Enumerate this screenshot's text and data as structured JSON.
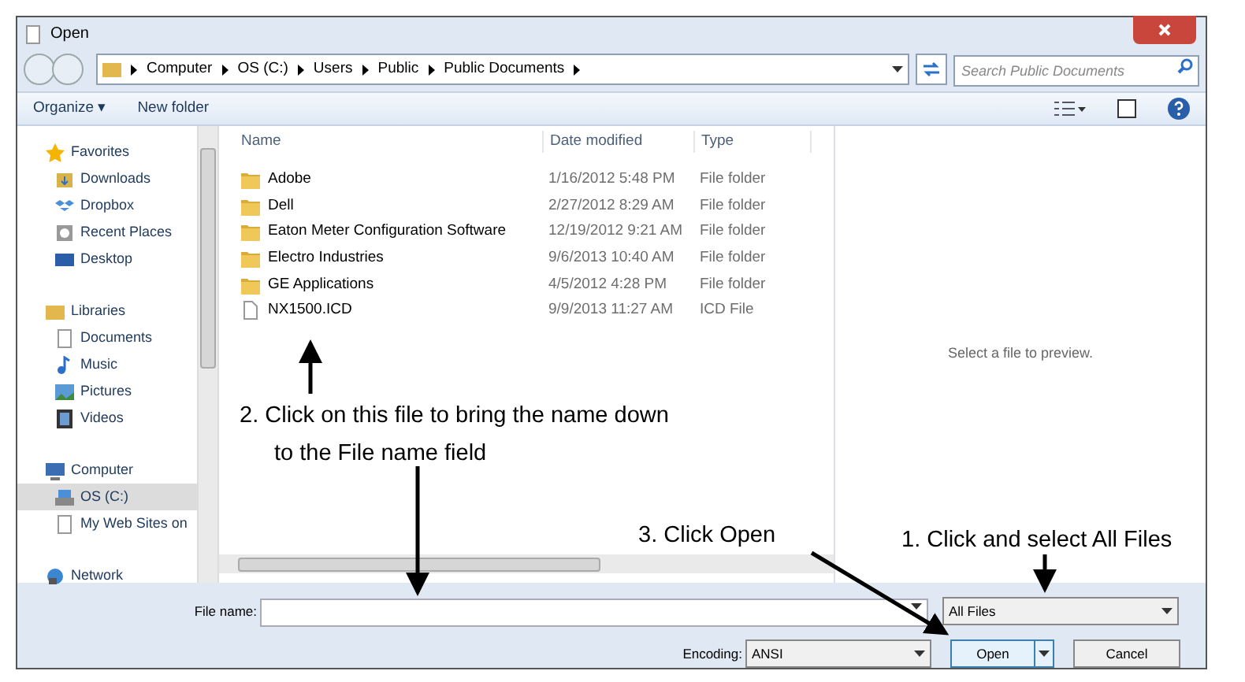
{
  "window": {
    "title": "Open"
  },
  "address": {
    "crumbs": [
      "Computer",
      "OS (C:)",
      "Users",
      "Public",
      "Public Documents"
    ]
  },
  "search": {
    "placeholder": "Search Public Documents"
  },
  "toolbar": {
    "buttons": [
      "Organize ▾",
      "New folder"
    ]
  },
  "sidebar": {
    "items": [
      {
        "label": "Favorites",
        "kind": "star",
        "selected": false,
        "children": [
          {
            "label": "Downloads",
            "kind": "downloads",
            "selected": false
          },
          {
            "label": "Dropbox",
            "kind": "dropbox",
            "selected": false
          },
          {
            "label": "Recent Places",
            "kind": "recent",
            "selected": false
          },
          {
            "label": "Desktop",
            "kind": "desktop",
            "selected": false
          }
        ]
      },
      {
        "label": "Libraries",
        "kind": "library",
        "selected": false,
        "children": [
          {
            "label": "Documents",
            "kind": "doc",
            "selected": false
          },
          {
            "label": "Music",
            "kind": "music",
            "selected": false
          },
          {
            "label": "Pictures",
            "kind": "pictures",
            "selected": false
          },
          {
            "label": "Videos",
            "kind": "videos",
            "selected": false
          }
        ]
      },
      {
        "label": "Computer",
        "kind": "computer",
        "selected": false,
        "children": [
          {
            "label": "OS (C:)",
            "kind": "drive",
            "selected": true
          },
          {
            "label": "My Web Sites on",
            "kind": "doc",
            "selected": false
          }
        ]
      },
      {
        "label": "Network",
        "kind": "network",
        "selected": false
      }
    ]
  },
  "table": {
    "columns": [
      "Name",
      "Date modified",
      "Type"
    ],
    "rows": [
      {
        "name": "Adobe",
        "date": "1/16/2012 5:48 PM",
        "type": "File folder",
        "kind": "folder"
      },
      {
        "name": "Dell",
        "date": "2/27/2012 8:29 AM",
        "type": "File folder",
        "kind": "folder"
      },
      {
        "name": "Eaton Meter Configuration Software",
        "date": "12/19/2012 9:21 AM",
        "type": "File folder",
        "kind": "folder"
      },
      {
        "name": "Electro Industries",
        "date": "9/6/2013 10:40 AM",
        "type": "File folder",
        "kind": "folder"
      },
      {
        "name": "GE Applications",
        "date": "4/5/2012 4:28 PM",
        "type": "File folder",
        "kind": "folder"
      },
      {
        "name": "NX1500.ICD",
        "date": "9/9/2013 11:27 AM",
        "type": "ICD File",
        "kind": "file"
      }
    ]
  },
  "preview": {
    "text": "Select a file to preview."
  },
  "file_name": {
    "label": "File name:"
  },
  "file_type": {
    "value": "All Files"
  },
  "encoding": {
    "label": "Encoding:",
    "value": "ANSI"
  },
  "buttons": [
    "Open",
    "Cancel"
  ],
  "annotations": [
    {
      "lines": [
        "2. Click on this file to bring the name down",
        "to the File name field"
      ]
    },
    {
      "lines": [
        "3. Click Open"
      ]
    },
    {
      "lines": [
        "1. Click and select All Files"
      ]
    }
  ]
}
